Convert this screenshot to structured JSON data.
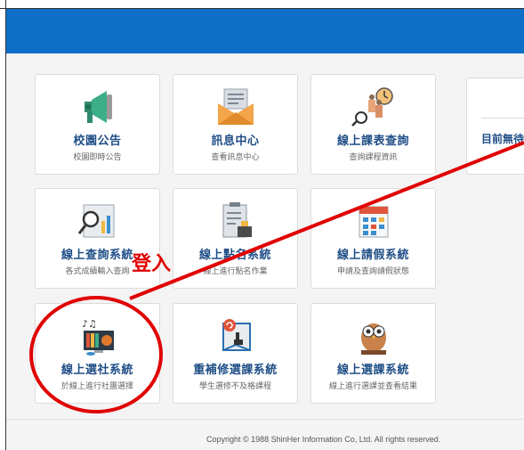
{
  "tiles": [
    {
      "title": "校園公告",
      "subtitle": "校園即時公告",
      "icon": "megaphone-icon"
    },
    {
      "title": "訊息中心",
      "subtitle": "查看訊息中心",
      "icon": "envelope-icon"
    },
    {
      "title": "線上課表查詢",
      "subtitle": "查詢課程資訊",
      "icon": "schedule-icon"
    },
    {
      "title": "線上查詢系統",
      "subtitle": "各式成績輸入查詢",
      "icon": "search-report-icon"
    },
    {
      "title": "線上點名系統",
      "subtitle": "線上進行點名作業",
      "icon": "clipboard-icon"
    },
    {
      "title": "線上請假系統",
      "subtitle": "申請及查詢請假狀態",
      "icon": "calendar-icon"
    },
    {
      "title": "線上選社系統",
      "subtitle": "於線上進行社團選擇",
      "icon": "club-books-icon"
    },
    {
      "title": "重補修選課系統",
      "subtitle": "學生選修不及格課程",
      "icon": "retake-screen-icon"
    },
    {
      "title": "線上選課系統",
      "subtitle": "線上進行選課並查看結果",
      "icon": "owl-icon"
    }
  ],
  "notice": {
    "text": "目前無待"
  },
  "footer": {
    "copyright": "Copyright © 1988 ShinHer Information Co, Ltd. All rights reserved."
  },
  "annotation": {
    "label": "登入",
    "color": "#e00000"
  },
  "colors": {
    "header": "#0f6fc7",
    "title": "#1f4e86"
  }
}
